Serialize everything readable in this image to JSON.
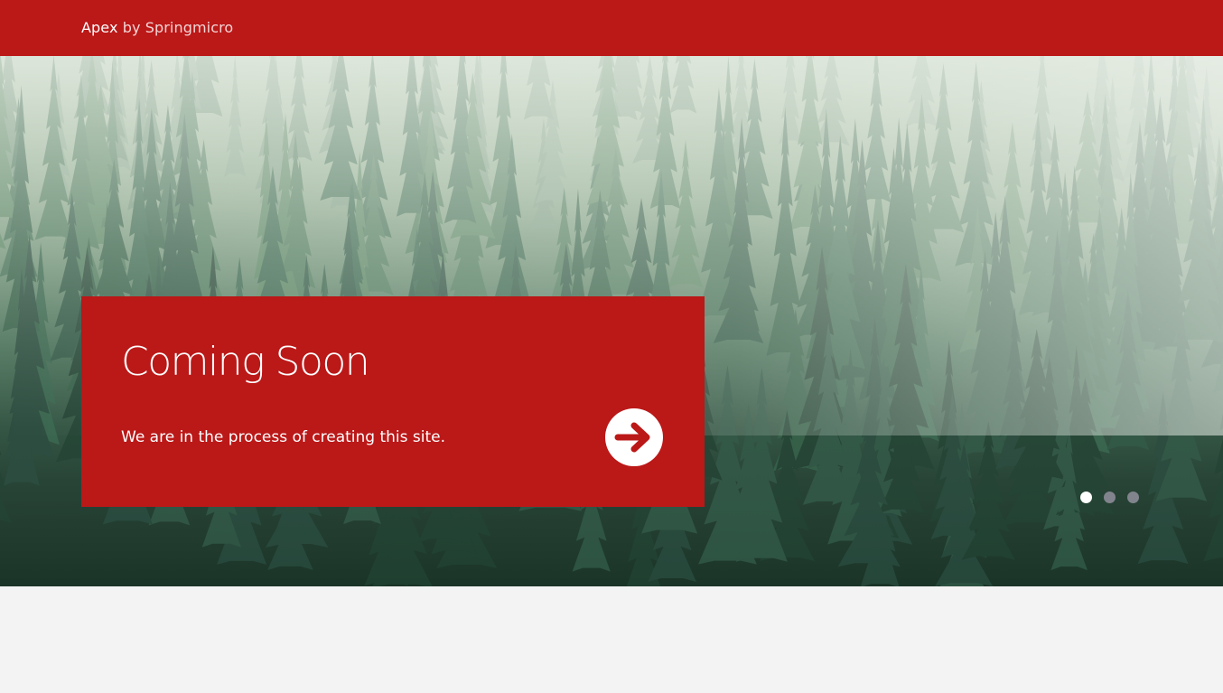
{
  "header": {
    "brand_name": "Apex",
    "brand_by": "by Springmicro",
    "background_color": "#bb1818"
  },
  "hero": {
    "background": "misty pine forest photo",
    "card": {
      "title": "Coming Soon",
      "text": "We are in the process of creating this site.",
      "arrow_icon": "arrow-right-circle-icon",
      "background_color": "#bb1818"
    },
    "slider": {
      "slide_count": 3,
      "active_index": 0
    }
  },
  "colors": {
    "accent": "#bb1818",
    "page_background": "#f3f3f3"
  }
}
